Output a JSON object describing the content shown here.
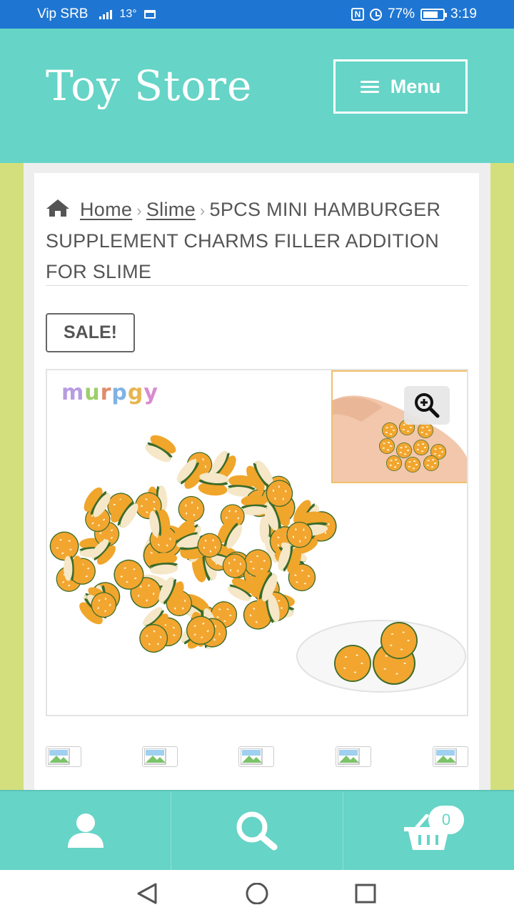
{
  "status_bar": {
    "carrier": "Vip SRB",
    "temperature": "13°",
    "battery_percent": "77%",
    "time": "3:19"
  },
  "header": {
    "site_title": "Toy Store",
    "menu_label": "Menu"
  },
  "breadcrumb": {
    "home": "Home",
    "category": "Slime",
    "current": "5PCS MINI HAMBURGER SUPPLEMENT CHARMS FILLER ADDITION FOR SLIME"
  },
  "product": {
    "badge": "SALE!",
    "brand_watermark": "murpgy",
    "thumbnail_count": 5
  },
  "bottom_nav": {
    "account_icon": "user-icon",
    "search_icon": "search-icon",
    "cart_icon": "basket-icon",
    "cart_count": "0"
  },
  "colors": {
    "header_bg": "#66d4c7",
    "page_bg": "#d3df7c",
    "status_bar_bg": "#1f76d2"
  }
}
